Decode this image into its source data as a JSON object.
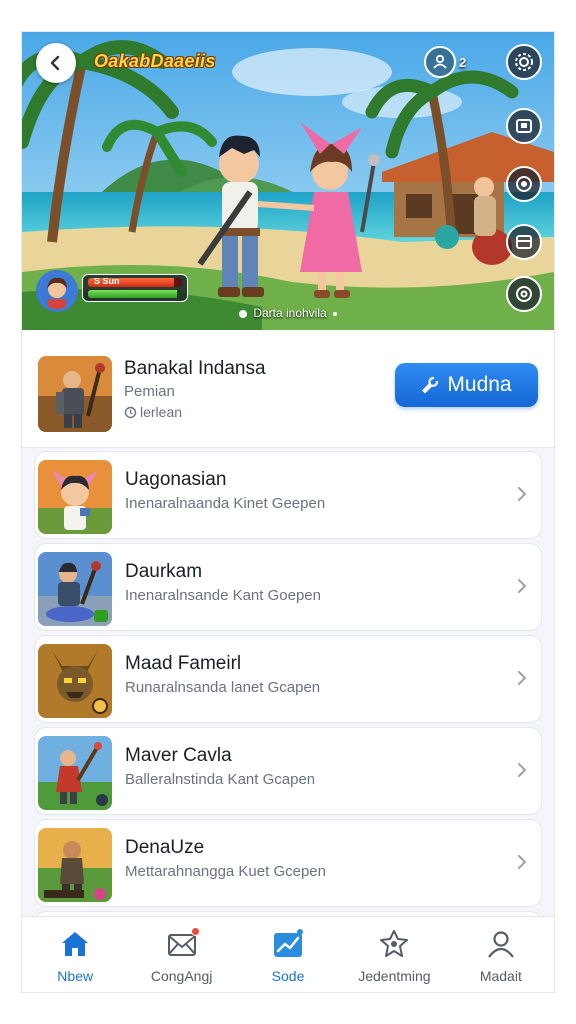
{
  "colors": {
    "accent": "#1a73d9",
    "button": "#1f78e3",
    "hp": "#d12c15",
    "sp": "#2f9d22",
    "title_gold": "#ffd54a"
  },
  "hero": {
    "title": "OakabDaaeiis",
    "player_count": "2",
    "hp_label": "S Sun",
    "hp_fraction": 0.92,
    "sp_fraction": 0.95,
    "caption": "Darta inohvila",
    "icons": {
      "back": "chevron-left-icon",
      "players": "group-icon",
      "settings": "gear-icon",
      "side": [
        "screen-icon",
        "record-icon",
        "card-icon",
        "target-icon"
      ]
    }
  },
  "featured": {
    "title": "Banakal Indansa",
    "subtitle": "Pemian",
    "tag": "lerlean",
    "button_label": "Mudna"
  },
  "games": [
    {
      "title": "Uagonasian",
      "subtitle": "Inenaralnaanda Kinet Geepen"
    },
    {
      "title": "Daurkam",
      "subtitle": "Inenaralnsande Kant Goepen"
    },
    {
      "title": "Maad Fameirl",
      "subtitle": "Runaralnsanda lanet Gcapen"
    },
    {
      "title": "Maver Cavla",
      "subtitle": "Balleralnstinda Kant Gcapen"
    },
    {
      "title": "DenaUze",
      "subtitle": "Mettarahnangga Kuet Gcepen"
    }
  ],
  "tabs": [
    {
      "label": "Nbew",
      "icon": "home-icon",
      "active": true
    },
    {
      "label": "CongAngj",
      "icon": "mail-icon",
      "active": false,
      "badge": true
    },
    {
      "label": "Sode",
      "icon": "chart-icon",
      "active": true
    },
    {
      "label": "Jedentming",
      "icon": "puzzle-icon",
      "active": false
    },
    {
      "label": "Madait",
      "icon": "person-icon",
      "active": false
    }
  ]
}
